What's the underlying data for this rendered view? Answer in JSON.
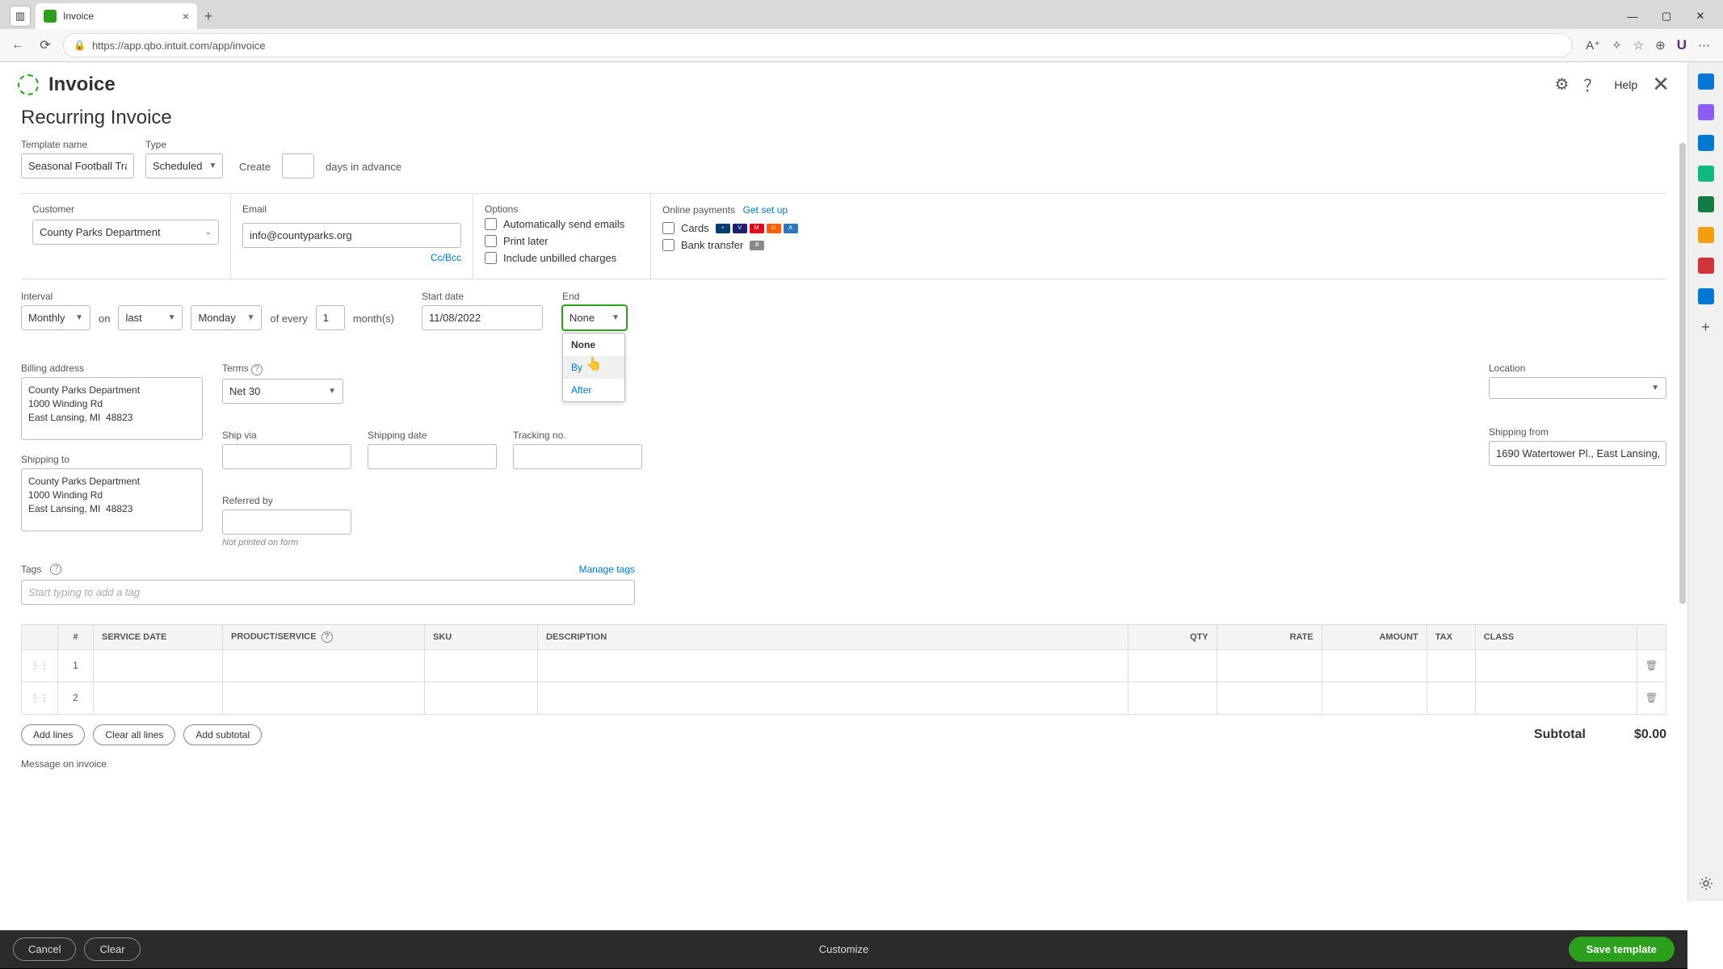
{
  "browser": {
    "tab_title": "Invoice",
    "url": "https://app.qbo.intuit.com/app/invoice"
  },
  "header": {
    "title": "Invoice",
    "help_label": "Help"
  },
  "page": {
    "section_title": "Recurring Invoice",
    "template_name_label": "Template name",
    "template_name_value": "Seasonal Football Train",
    "type_label": "Type",
    "type_value": "Scheduled",
    "create_label": "Create",
    "days_value": "",
    "days_suffix": "days in advance"
  },
  "customer_row": {
    "customer_label": "Customer",
    "customer_value": "County Parks Department",
    "email_label": "Email",
    "email_value": "info@countyparks.org",
    "ccbcc": "Cc/Bcc",
    "options_label": "Options",
    "opt_auto_email": "Automatically send emails",
    "opt_print_later": "Print later",
    "opt_unbilled": "Include unbilled charges",
    "payments_label": "Online payments",
    "payments_setup": "Get set up",
    "cards_label": "Cards",
    "bank_label": "Bank transfer"
  },
  "interval_row": {
    "interval_label": "Interval",
    "interval_value": "Monthly",
    "on_label": "on",
    "day_pos_value": "last",
    "day_name_value": "Monday",
    "of_every_label": "of every",
    "every_value": "1",
    "months_label": "month(s)",
    "start_label": "Start date",
    "start_value": "11/08/2022",
    "end_label": "End",
    "end_value": "None",
    "dropdown": {
      "none": "None",
      "by": "By",
      "after": "After"
    }
  },
  "details": {
    "billing_label": "Billing address",
    "billing_value": "County Parks Department\n1000 Winding Rd\nEast Lansing, MI  48823",
    "shipping_to_label": "Shipping to",
    "shipping_to_value": "County Parks Department\n1000 Winding Rd\nEast Lansing, MI  48823",
    "terms_label": "Terms",
    "terms_value": "Net 30",
    "shipvia_label": "Ship via",
    "shipdate_label": "Shipping date",
    "tracking_label": "Tracking no.",
    "referred_label": "Referred by",
    "referred_hint": "Not printed on form",
    "location_label": "Location",
    "shipfrom_label": "Shipping from",
    "shipfrom_value": "1690 Watertower Pl., East Lansing,"
  },
  "tags": {
    "label": "Tags",
    "manage": "Manage tags",
    "placeholder": "Start typing to add a tag"
  },
  "table": {
    "headers": {
      "num": "#",
      "date": "SERVICE DATE",
      "product": "PRODUCT/SERVICE",
      "sku": "SKU",
      "desc": "DESCRIPTION",
      "qty": "QTY",
      "rate": "RATE",
      "amount": "AMOUNT",
      "tax": "TAX",
      "class": "CLASS"
    },
    "rows": [
      {
        "n": "1"
      },
      {
        "n": "2"
      }
    ],
    "add_lines": "Add lines",
    "clear_lines": "Clear all lines",
    "add_subtotal": "Add subtotal",
    "subtotal_label": "Subtotal",
    "subtotal_value": "$0.00",
    "msg_label": "Message on invoice"
  },
  "footer": {
    "cancel": "Cancel",
    "clear": "Clear",
    "customize": "Customize",
    "save": "Save template"
  }
}
